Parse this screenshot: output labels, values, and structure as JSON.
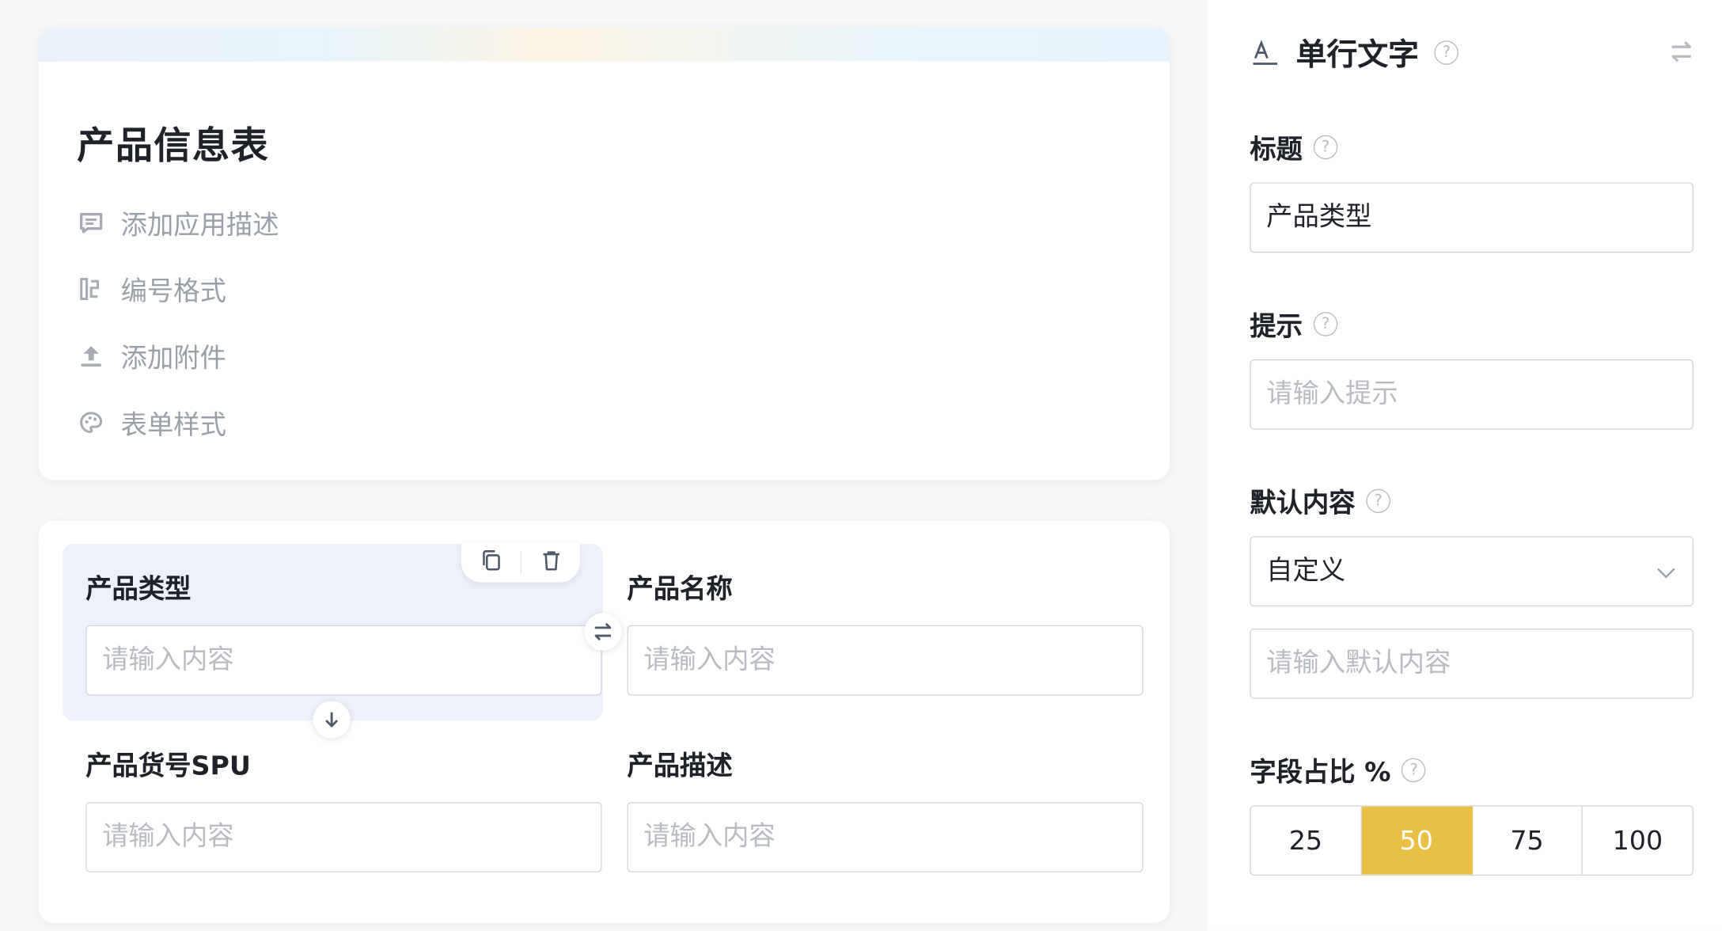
{
  "form": {
    "title": "产品信息表",
    "meta": [
      {
        "label": "添加应用描述",
        "icon": "comment-icon"
      },
      {
        "label": "编号格式",
        "icon": "numbering-icon"
      },
      {
        "label": "添加附件",
        "icon": "upload-icon"
      },
      {
        "label": "表单样式",
        "icon": "palette-icon"
      }
    ],
    "fields": [
      {
        "label": "产品类型",
        "placeholder": "请输入内容"
      },
      {
        "label": "产品名称",
        "placeholder": "请输入内容"
      },
      {
        "label": "产品货号SPU",
        "placeholder": "请输入内容"
      },
      {
        "label": "产品描述",
        "placeholder": "请输入内容"
      }
    ]
  },
  "panel": {
    "type_title": "单行文字",
    "title_label": "标题",
    "title_value": "产品类型",
    "hint_label": "提示",
    "hint_placeholder": "请输入提示",
    "default_label": "默认内容",
    "default_select": "自定义",
    "default_placeholder": "请输入默认内容",
    "width_label": "字段占比 %",
    "width_options": [
      "25",
      "50",
      "75",
      "100"
    ],
    "width_selected": "50"
  },
  "colors": {
    "accent": "#e9bf45",
    "selected_bg": "#eef1fb"
  }
}
